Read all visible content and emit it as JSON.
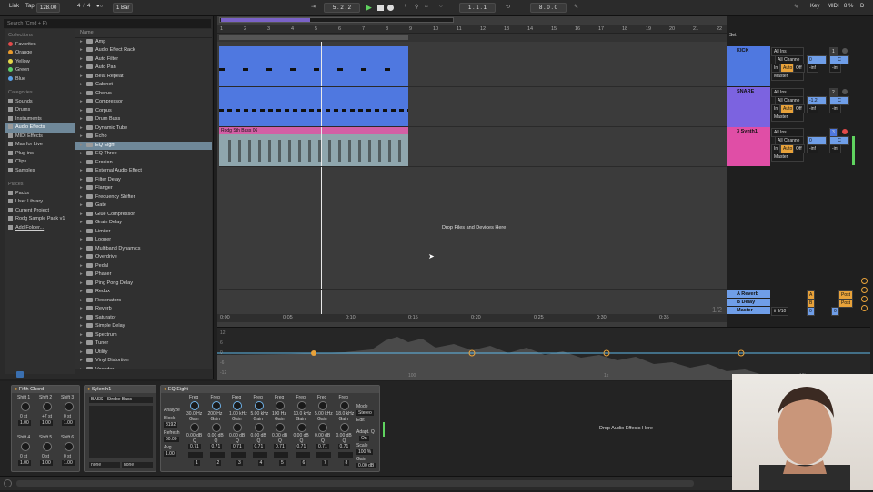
{
  "transport": {
    "link": "Link",
    "tap": "Tap",
    "tempo": "128.00",
    "sig_num": "4",
    "sig_den": "4",
    "metro": "●○",
    "quantize": "1 Bar",
    "position": "5 .  2 .  2",
    "loop_start": "1 .  1 .  1",
    "loop_len": "8 .  0 .  0",
    "key": "Key",
    "midi": "MIDI",
    "cpu": "8 %",
    "d": "D"
  },
  "browser": {
    "search_placeholder": "Search (Cmd + F)",
    "collections_title": "Collections",
    "collections": [
      {
        "label": "Favorites",
        "color": "#e24a4a"
      },
      {
        "label": "Orange",
        "color": "#e89a2c"
      },
      {
        "label": "Yellow",
        "color": "#e6d84a"
      },
      {
        "label": "Green",
        "color": "#5bcf6a"
      },
      {
        "label": "Blue",
        "color": "#5aa0e6"
      }
    ],
    "categories_title": "Categories",
    "categories": [
      "Sounds",
      "Drums",
      "Instruments",
      "Audio Effects",
      "MIDI Effects",
      "Max for Live",
      "Plug-ins",
      "Clips",
      "Samples"
    ],
    "places_title": "Places",
    "places": [
      "Packs",
      "User Library",
      "Current Project",
      "Rodg Sample Pack v1",
      "Add Folder..."
    ],
    "name_header": "Name",
    "items": [
      "Amp",
      "Audio Effect Rack",
      "Auto Filter",
      "Auto Pan",
      "Beat Repeat",
      "Cabinet",
      "Chorus",
      "Compressor",
      "Corpus",
      "Drum Buss",
      "Dynamic Tube",
      "Echo",
      "EQ Eight",
      "EQ Three",
      "Erosion",
      "External Audio Effect",
      "Filter Delay",
      "Flanger",
      "Frequency Shifter",
      "Gate",
      "Glue Compressor",
      "Grain Delay",
      "Limiter",
      "Looper",
      "Multiband Dynamics",
      "Overdrive",
      "Pedal",
      "Phaser",
      "Ping Pong Delay",
      "Redux",
      "Resonators",
      "Reverb",
      "Saturator",
      "Simple Delay",
      "Spectrum",
      "Tuner",
      "Utility",
      "Vinyl Distortion",
      "Vocoder"
    ]
  },
  "arrangement": {
    "ruler": [
      "1",
      "2",
      "3",
      "4",
      "5",
      "6",
      "7",
      "8",
      "9",
      "10",
      "11",
      "12",
      "13",
      "14",
      "15",
      "16",
      "17",
      "18",
      "19",
      "20",
      "21",
      "22"
    ],
    "time_ruler": [
      "0:00",
      "0:05",
      "0:10",
      "0:15",
      "0:20",
      "0:25",
      "0:30",
      "0:35"
    ],
    "drop_text": "Drop Files and Devices Here",
    "bass_clip": "Rodg Sth Bass 06",
    "page": "1/2",
    "set_label": "Set"
  },
  "tracks": [
    {
      "name": "KICK",
      "color": "#4f78e0",
      "input": "All Ins",
      "channel": "All Channe",
      "in": "In",
      "auto": "Auto",
      "off": "Off",
      "out": "Master",
      "vol": "0",
      "pan": "C",
      "num": "1",
      "db1": "-inf",
      "db2": "-inf"
    },
    {
      "name": "SNARE",
      "color": "#7c63e0",
      "input": "All Ins",
      "channel": "All Channe",
      "in": "In",
      "auto": "Auto",
      "off": "Off",
      "out": "Master",
      "vol": "-1.2",
      "pan": "C",
      "num": "2",
      "db1": "-inf",
      "db2": "-inf"
    },
    {
      "name": "3 Synth1",
      "color": "#e04ea6",
      "input": "All Ins",
      "channel": "All Channe",
      "in": "In",
      "auto": "Auto",
      "off": "Off",
      "out": "Master",
      "vol": "0",
      "pan": "C",
      "num": "3",
      "db1": "-inf",
      "db2": "-inf"
    }
  ],
  "returns": [
    {
      "name": "A Reverb",
      "letter": "A",
      "post": "Post"
    },
    {
      "name": "B Delay",
      "letter": "B",
      "post": "Post"
    },
    {
      "name": "Master",
      "io": "ii 9/10",
      "vol": "0",
      "pan": "0"
    }
  ],
  "eq_display": {
    "y_labels": [
      "12",
      "6",
      "0",
      "-6",
      "-12"
    ],
    "x_labels": [
      "100",
      "1k",
      "10k"
    ]
  },
  "devices": {
    "fifth_chord": {
      "title": "Fifth Chord",
      "shifts": [
        {
          "label": "Shift 1",
          "st": "0 st",
          "vel": "1.00"
        },
        {
          "label": "Shift 2",
          "st": "+7 st",
          "vel": "1.00"
        },
        {
          "label": "Shift 3",
          "st": "0 st",
          "vel": "1.00"
        },
        {
          "label": "Shift 4",
          "st": "0 st",
          "vel": "1.00"
        },
        {
          "label": "Shift 5",
          "st": "0 st",
          "vel": "1.00"
        },
        {
          "label": "Shift 6",
          "st": "0 st",
          "vel": "1.00"
        }
      ]
    },
    "sylenth": {
      "title": "Sylenth1",
      "preset": "BASS - Strobe Bass",
      "sel1": "none",
      "sel2": "none"
    },
    "eq_eight": {
      "title": "EQ Eight",
      "analyze": "Analyze",
      "block": "Block",
      "block_val": "8192",
      "refresh": "Refresh",
      "refresh_val": "60.00",
      "avg": "Avg",
      "avg_val": "1.00",
      "bands": [
        {
          "freq": "30.0 Hz",
          "gain": "0.00 dB",
          "q": "0.71",
          "num": "1"
        },
        {
          "freq": "200 Hz",
          "gain": "0.00 dB",
          "q": "0.71",
          "num": "2"
        },
        {
          "freq": "1.00 kHz",
          "gain": "0.00 dB",
          "q": "0.71",
          "num": "3"
        },
        {
          "freq": "5.00 kHz",
          "gain": "0.00 dB",
          "q": "0.71",
          "num": "4"
        },
        {
          "freq": "100 Hz",
          "gain": "0.00 dB",
          "q": "0.71",
          "num": "5"
        },
        {
          "freq": "10.0 kHz",
          "gain": "0.00 dB",
          "q": "0.71",
          "num": "6"
        },
        {
          "freq": "5.00 kHz",
          "gain": "0.00 dB",
          "q": "0.71",
          "num": "7"
        },
        {
          "freq": "18.0 kHz",
          "gain": "0.00 dB",
          "q": "0.71",
          "num": "8"
        }
      ],
      "freq_label": "Freq",
      "gain_label": "Gain",
      "q_label": "Q",
      "mode": "Mode",
      "mode_val": "Stereo",
      "edit": "Edit",
      "adapt_q": "Adapt. Q",
      "on": "On",
      "scale": "Scale",
      "scale_val": "100 %",
      "gain_out": "Gain",
      "gain_out_val": "0.00 dB"
    },
    "drop_audio": "Drop Audio Effects Here"
  }
}
